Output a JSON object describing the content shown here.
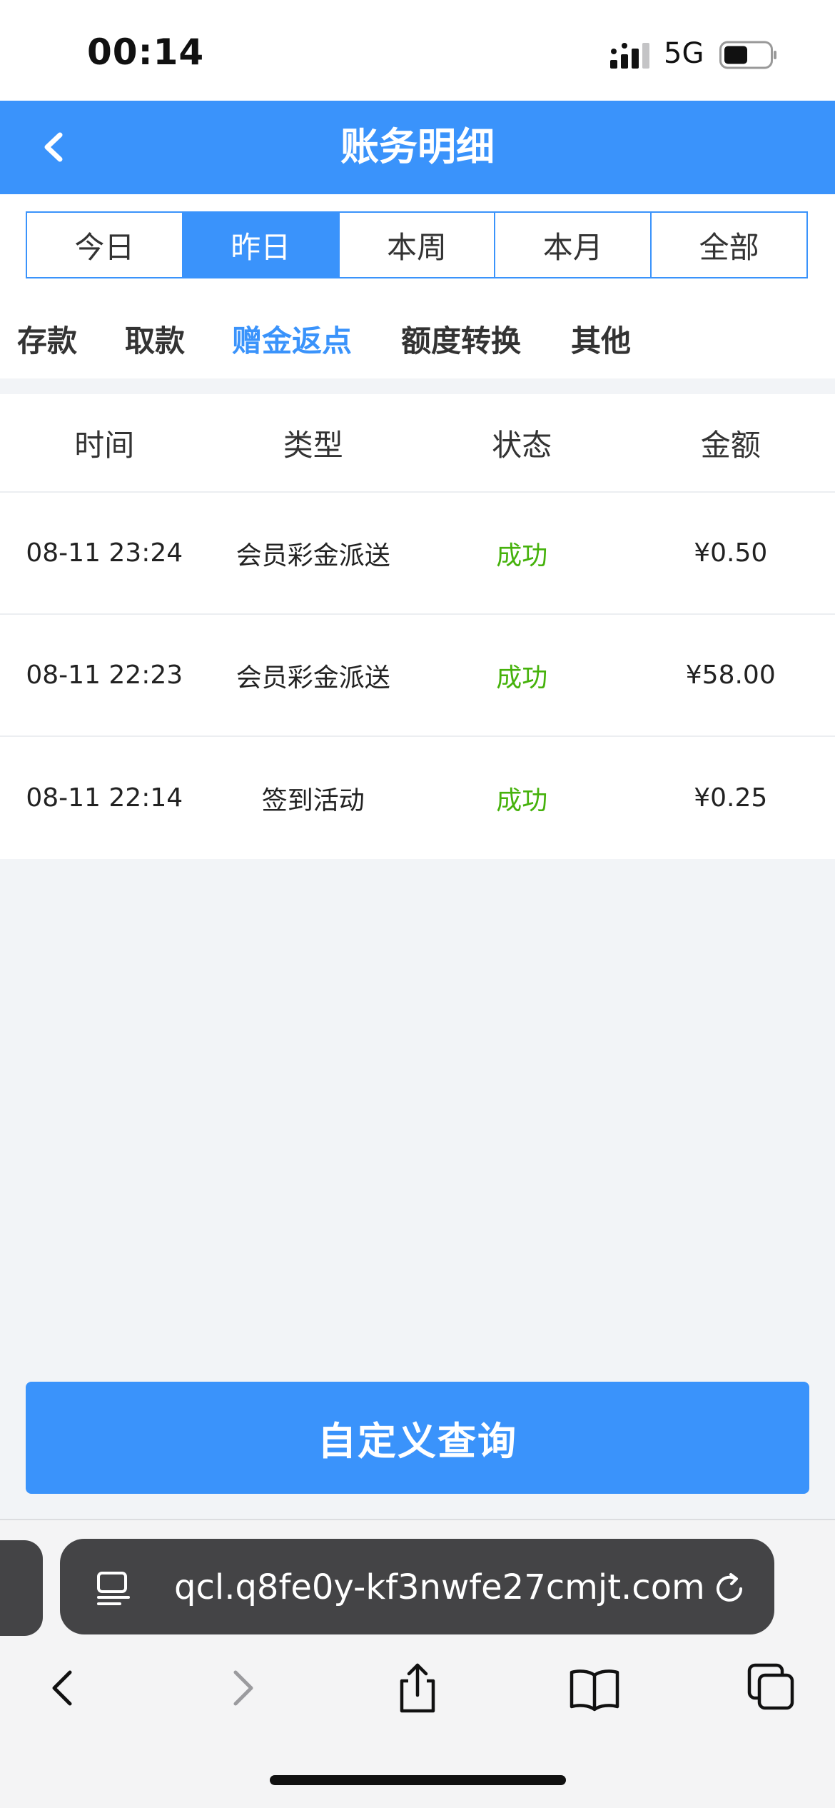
{
  "status_bar": {
    "time": "00:14",
    "network": "5G",
    "signal_icon": "cellular-signal-icon",
    "battery_icon": "battery-icon"
  },
  "header": {
    "title": "账务明细",
    "back_icon": "chevron-left-icon"
  },
  "period_tabs": [
    {
      "label": "今日",
      "active": false
    },
    {
      "label": "昨日",
      "active": true
    },
    {
      "label": "本周",
      "active": false
    },
    {
      "label": "本月",
      "active": false
    },
    {
      "label": "全部",
      "active": false
    }
  ],
  "category_tabs": [
    {
      "label": "存款",
      "active": false
    },
    {
      "label": "取款",
      "active": false
    },
    {
      "label": "赠金返点",
      "active": true
    },
    {
      "label": "额度转换",
      "active": false
    },
    {
      "label": "其他",
      "active": false
    }
  ],
  "table": {
    "headers": [
      "时间",
      "类型",
      "状态",
      "金额"
    ],
    "rows": [
      {
        "time": "08-11 23:24",
        "type": "会员彩金派送",
        "status": "成功",
        "amount": "¥0.50"
      },
      {
        "time": "08-11 22:23",
        "type": "会员彩金派送",
        "status": "成功",
        "amount": "¥58.00"
      },
      {
        "time": "08-11 22:14",
        "type": "签到活动",
        "status": "成功",
        "amount": "¥0.25"
      }
    ]
  },
  "custom_query_button": "自定义查询",
  "browser": {
    "url": "qcl.q8fe0y-kf3nwfe27cmjt.com",
    "page_icon": "page-menu-icon",
    "reload_icon": "reload-icon",
    "toolbar": [
      "back-icon",
      "forward-icon",
      "share-icon",
      "bookmarks-icon",
      "tabs-icon"
    ]
  },
  "colors": {
    "accent": "#3a93fb",
    "success": "#46b20c",
    "background": "#f2f4f7"
  }
}
